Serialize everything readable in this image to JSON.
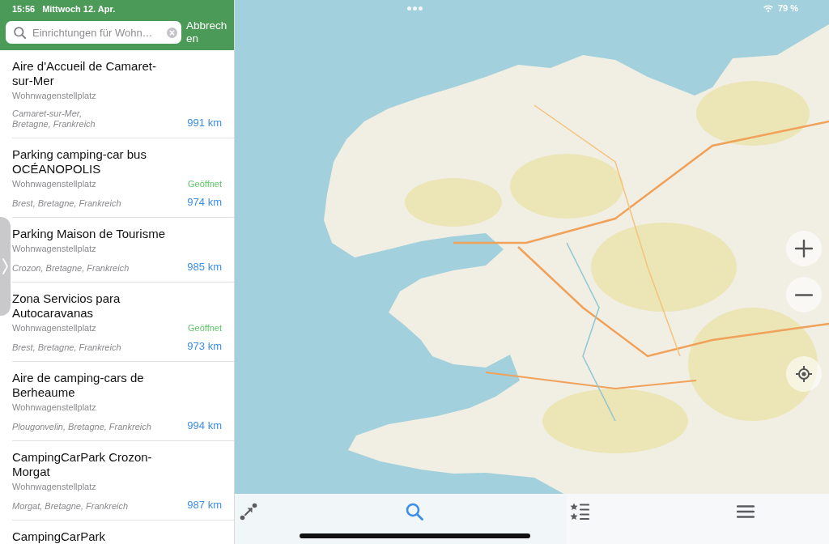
{
  "status_bar": {
    "time": "15:56",
    "date": "Mittwoch 12. Apr.",
    "battery": "79 %"
  },
  "search": {
    "placeholder": "Einrichtungen für Wohn…",
    "cancel": "Abbrechen"
  },
  "results": [
    {
      "name": "Aire d'Accueil de Camaret-sur-Mer",
      "category": "Wohnwagenstellplatz",
      "address": "Camaret-sur-Mer, Bretagne, Frankreich",
      "distance": "991 km"
    },
    {
      "name": "Parking camping-car bus OCÉANOPOLIS",
      "category": "Wohnwagenstellplatz",
      "status": "Geöffnet",
      "address": "Brest, Bretagne, Frankreich",
      "distance": "974 km"
    },
    {
      "name": "Parking Maison de Tourisme",
      "category": "Wohnwagenstellplatz",
      "address": "Crozon, Bretagne, Frankreich",
      "distance": "985 km"
    },
    {
      "name": "Zona Servicios para Autocaravanas",
      "category": "Wohnwagenstellplatz",
      "status": "Geöffnet",
      "address": "Brest, Bretagne, Frankreich",
      "distance": "973 km"
    },
    {
      "name": "Aire de camping-cars de Berheaume",
      "category": "Wohnwagenstellplatz",
      "address": "Plougonvelin, Bretagne, Frankreich",
      "distance": "994 km"
    },
    {
      "name": "CampingCarPark Crozon-Morgat",
      "category": "Wohnwagenstellplatz",
      "address": "Morgat, Bretagne, Frankreich",
      "distance": "987 km"
    },
    {
      "name": "CampingCarPark"
    }
  ],
  "map_controls": [
    {
      "kind": "zoom_in"
    },
    {
      "kind": "zoom_out"
    },
    {
      "kind": "locate"
    }
  ],
  "toolbar": [
    {
      "kind": "route",
      "selected": false
    },
    {
      "kind": "search",
      "selected": true
    },
    {
      "kind": "favorites",
      "selected": false
    },
    {
      "kind": "menu",
      "selected": false
    }
  ]
}
